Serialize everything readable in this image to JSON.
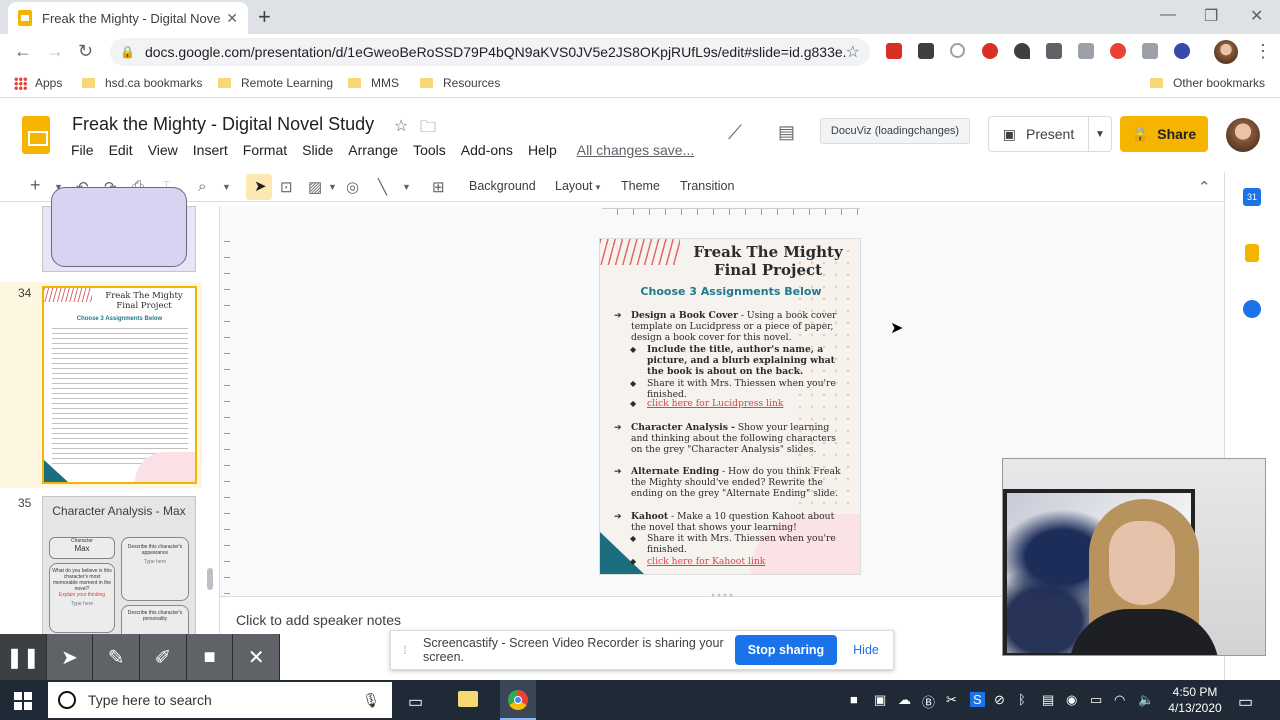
{
  "browser": {
    "tab_title": "Freak the Mighty - Digital Novel",
    "url": "docs.google.com/presentation/d/1eGweoBeRoSSD79P4bQN9aKVS0JV5e2JS8OKpjRUfL9s/edit#slide=id.g833e...",
    "bookmarks": [
      "Apps",
      "hsd.ca bookmarks",
      "Remote Learning",
      "MMS",
      "Resources"
    ],
    "other_bookmarks": "Other bookmarks"
  },
  "slides_app": {
    "doc_title": "Freak the Mighty - Digital Novel Study",
    "menu": [
      "File",
      "Edit",
      "View",
      "Insert",
      "Format",
      "Slide",
      "Arrange",
      "Tools",
      "Add-ons",
      "Help"
    ],
    "save_status": "All changes save...",
    "docuviz": "DocuViz (loadingchanges)",
    "present_label": "Present",
    "share_label": "Share"
  },
  "toolbar": {
    "background": "Background",
    "layout": "Layout",
    "theme": "Theme",
    "transition": "Transition"
  },
  "filmstrip": {
    "slide34_num": "34",
    "slide35_num": "35",
    "thumb34": {
      "title": "Freak The Mighty Final Project",
      "sub": "Choose 3 Assignments Below"
    },
    "thumb35": {
      "title": "Character Analysis - Max",
      "character_label": "Character",
      "character_name": "Max",
      "appearance": "Describe this character's appearance",
      "moment": "What do you believe is this character's most memorable moment in the novel?",
      "explain": "Explain your thinking",
      "personality": "Describe this character's personality",
      "type_here": "Type here"
    }
  },
  "slide": {
    "title_line1": "Freak The Mighty",
    "title_line2": "Final Project",
    "subtitle": "Choose 3 Assignments Below",
    "item1_bold": "Design a Book Cover",
    "item1_text": " - Using a book cover template on Lucidpress or a piece of paper, design a book cover for this novel.",
    "item1_sub1": "Include the title, author's name, a picture, and a blurb explaining what the book is about on the back.",
    "item1_sub2": "Share it with Mrs. Thiessen when you're finished.",
    "item1_link": "click here for Lucidpress link",
    "item2_bold": "Character Analysis -",
    "item2_text": " Show your learning and thinking about the following characters on the grey \"Character Analysis\" slides.",
    "item3_bold": "Alternate Ending",
    "item3_text": " - How do you think Freak the Mighty should've ended? Rewrite the ending on the grey \"Alternate Ending\" slide.",
    "item4_bold": "Kahoot",
    "item4_text": " - Make a 10 question Kahoot about the novel that shows your learning!",
    "item4_sub1": "Share it with Mrs. Thiessen when you're finished.",
    "item4_link": "click here for Kahoot link"
  },
  "notes_placeholder": "Click to add speaker notes",
  "screen_share": {
    "message": "Screencastify - Screen Video Recorder is sharing your screen.",
    "stop": "Stop sharing",
    "hide": "Hide"
  },
  "taskbar": {
    "search_placeholder": "Type here to search",
    "time": "4:50 PM",
    "date": "4/13/2020"
  },
  "colors": {
    "accent_yellow": "#f4b400",
    "link_blue": "#1a73e8",
    "slide_teal": "#1f7a8c",
    "slide_link_red": "#d64545"
  }
}
